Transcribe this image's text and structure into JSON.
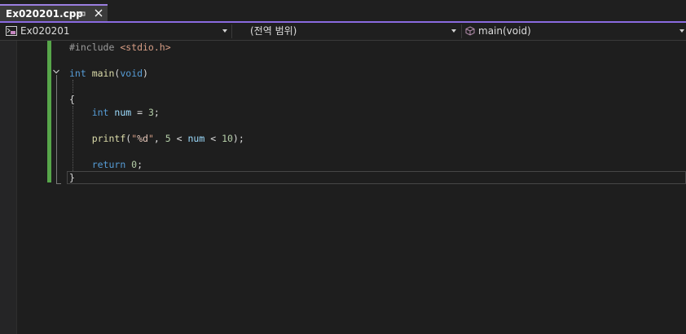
{
  "tab": {
    "title": "Ex020201.cpp",
    "pin_icon": "pin-icon",
    "close_icon": "close-icon",
    "accent_color": "#8a6ae0"
  },
  "navbar": {
    "project": "Ex020201",
    "scope": "(전역 범위)",
    "member": "main(void)",
    "project_icon": "project-icon",
    "member_icon": "cube-icon"
  },
  "editor": {
    "lines": [
      {
        "tokens": [
          {
            "t": "#include ",
            "c": "pre"
          },
          {
            "t": "<stdio.h>",
            "c": "str"
          }
        ]
      },
      {
        "tokens": []
      },
      {
        "tokens": [
          {
            "t": "int ",
            "c": "kw"
          },
          {
            "t": "main",
            "c": "fn"
          },
          {
            "t": "(",
            "c": "plain"
          },
          {
            "t": "void",
            "c": "kw"
          },
          {
            "t": ")",
            "c": "plain"
          }
        ]
      },
      {
        "tokens": []
      },
      {
        "tokens": [
          {
            "t": "{",
            "c": "plain"
          }
        ]
      },
      {
        "tokens": [
          {
            "t": "    ",
            "c": "plain"
          },
          {
            "t": "int ",
            "c": "kw"
          },
          {
            "t": "num",
            "c": "var"
          },
          {
            "t": " = ",
            "c": "plain"
          },
          {
            "t": "3",
            "c": "num"
          },
          {
            "t": ";",
            "c": "plain"
          }
        ]
      },
      {
        "tokens": []
      },
      {
        "tokens": [
          {
            "t": "    ",
            "c": "plain"
          },
          {
            "t": "printf",
            "c": "fn"
          },
          {
            "t": "(",
            "c": "plain"
          },
          {
            "t": "\"",
            "c": "str"
          },
          {
            "t": "%d",
            "c": "fmt"
          },
          {
            "t": "\"",
            "c": "str"
          },
          {
            "t": ", ",
            "c": "plain"
          },
          {
            "t": "5",
            "c": "num"
          },
          {
            "t": " < ",
            "c": "plain"
          },
          {
            "t": "num",
            "c": "var"
          },
          {
            "t": " < ",
            "c": "plain"
          },
          {
            "t": "10",
            "c": "num"
          },
          {
            "t": ");",
            "c": "plain"
          }
        ]
      },
      {
        "tokens": []
      },
      {
        "tokens": [
          {
            "t": "    ",
            "c": "plain"
          },
          {
            "t": "return ",
            "c": "kw"
          },
          {
            "t": "0",
            "c": "num"
          },
          {
            "t": ";",
            "c": "plain"
          }
        ]
      },
      {
        "tokens": [
          {
            "t": "}",
            "c": "plain"
          }
        ]
      }
    ],
    "collapse_icon": "chevron-down-icon",
    "change_bar_color": "#57a64a"
  }
}
